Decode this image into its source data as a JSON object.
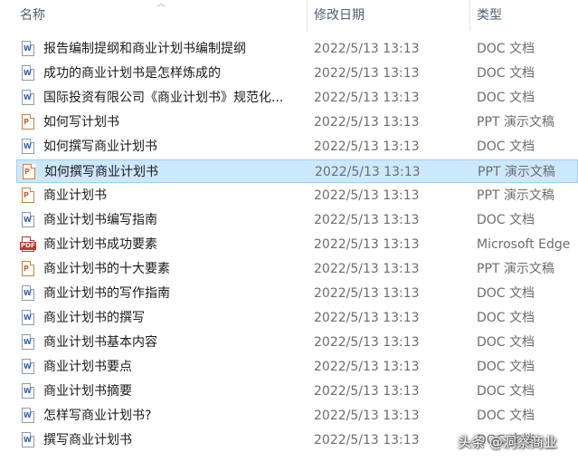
{
  "columns": {
    "name": "名称",
    "date_modified": "修改日期",
    "type": "类型",
    "sort_indicator": "︿"
  },
  "files": [
    {
      "name": "报告编制提纲和商业计划书编制提纲",
      "date": "2022/5/13 13:13",
      "type": "DOC 文档",
      "icon": "doc",
      "selected": false
    },
    {
      "name": "成功的商业计划书是怎样炼成的",
      "date": "2022/5/13 13:13",
      "type": "DOC 文档",
      "icon": "doc",
      "selected": false
    },
    {
      "name": "国际投资有限公司《商业计划书》规范化...",
      "date": "2022/5/13 13:13",
      "type": "DOC 文档",
      "icon": "doc",
      "selected": false
    },
    {
      "name": "如何写计划书",
      "date": "2022/5/13 13:13",
      "type": "PPT 演示文稿",
      "icon": "ppt",
      "selected": false
    },
    {
      "name": "如何撰写商业计划书",
      "date": "2022/5/13 13:13",
      "type": "DOC 文档",
      "icon": "doc",
      "selected": false
    },
    {
      "name": "如何撰写商业计划书",
      "date": "2022/5/13 13:13",
      "type": "PPT 演示文稿",
      "icon": "ppt",
      "selected": true
    },
    {
      "name": "商业计划书",
      "date": "2022/5/13 13:13",
      "type": "PPT 演示文稿",
      "icon": "ppt",
      "selected": false
    },
    {
      "name": "商业计划书编写指南",
      "date": "2022/5/13 13:13",
      "type": "DOC 文档",
      "icon": "doc",
      "selected": false
    },
    {
      "name": "商业计划书成功要素",
      "date": "2022/5/13 13:13",
      "type": "Microsoft Edge",
      "icon": "pdf",
      "selected": false
    },
    {
      "name": "商业计划书的十大要素",
      "date": "2022/5/13 13:13",
      "type": "PPT 演示文稿",
      "icon": "ppt",
      "selected": false
    },
    {
      "name": "商业计划书的写作指南",
      "date": "2022/5/13 13:13",
      "type": "DOC 文档",
      "icon": "doc",
      "selected": false
    },
    {
      "name": "商业计划书的撰写",
      "date": "2022/5/13 13:13",
      "type": "DOC 文档",
      "icon": "doc",
      "selected": false
    },
    {
      "name": "商业计划书基本内容",
      "date": "2022/5/13 13:13",
      "type": "DOC 文档",
      "icon": "doc",
      "selected": false
    },
    {
      "name": "商业计划书要点",
      "date": "2022/5/13 13:13",
      "type": "DOC 文档",
      "icon": "doc",
      "selected": false
    },
    {
      "name": "商业计划书摘要",
      "date": "2022/5/13 13:13",
      "type": "DOC 文档",
      "icon": "doc",
      "selected": false
    },
    {
      "name": "怎样写商业计划书?",
      "date": "2022/5/13 13:13",
      "type": "DOC 文档",
      "icon": "doc",
      "selected": false
    },
    {
      "name": "撰写商业计划书",
      "date": "2022/5/13 13:13",
      "type": "DOC 文档",
      "icon": "doc",
      "selected": false
    }
  ],
  "icon_marks": {
    "doc": "W",
    "ppt": "P",
    "pdf": "PDF"
  },
  "colors": {
    "selection_bg": "#cce8ff",
    "selection_border": "#99d1ff",
    "header_text": "#4c607a",
    "secondary_text": "#6d6d6d"
  },
  "watermark": "头条 @洞察商业"
}
